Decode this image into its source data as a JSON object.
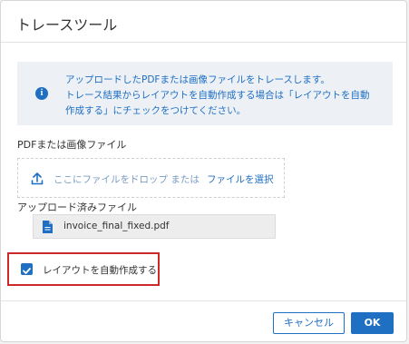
{
  "dialog": {
    "title": "トレースツール"
  },
  "info": {
    "icon": "info-icon",
    "line1": "アップロードしたPDFまたは画像ファイルをトレースします。",
    "line2": "トレース結果からレイアウトを自動作成する場合は「レイアウトを自動",
    "line3": "作成する」にチェックをつけてください。"
  },
  "file_input": {
    "label": "PDFまたは画像ファイル",
    "drop_text": "ここにファイルをドロップ または",
    "select_link": "ファイルを選択"
  },
  "uploaded": {
    "label": "アップロード済みファイル",
    "file_name": "invoice_final_fixed.pdf"
  },
  "options": {
    "auto_layout_label": "レイアウトを自動作成する",
    "auto_layout_checked": true
  },
  "buttons": {
    "cancel": "キャンセル",
    "ok": "OK"
  },
  "colors": {
    "accent": "#1f6fc3",
    "info_bg": "#edf1f6",
    "highlight": "#cc2a2a"
  }
}
